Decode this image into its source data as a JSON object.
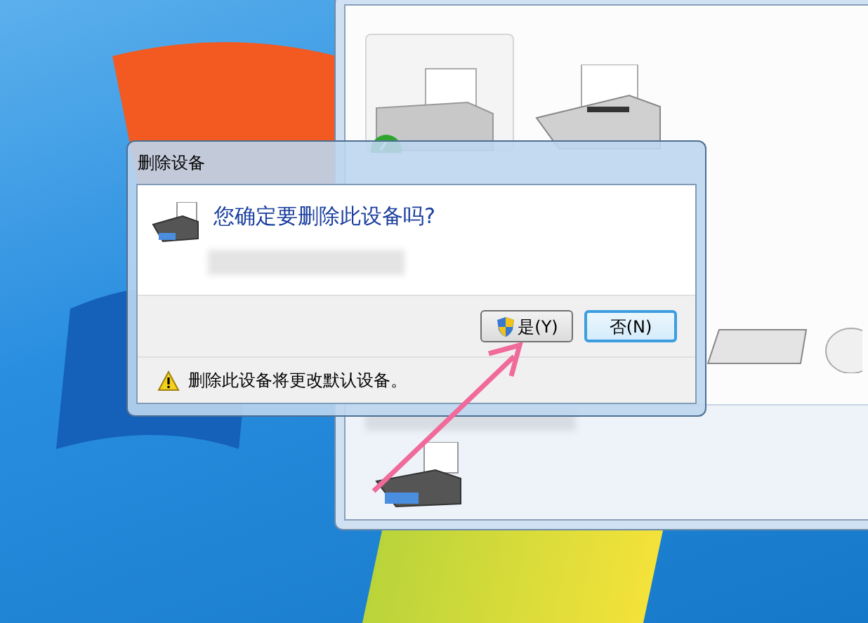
{
  "dialog": {
    "title": "删除设备",
    "question": "您确定要删除此设备吗?",
    "buttons": [
      {
        "label": "是(Y)",
        "kind": "shield",
        "default": false
      },
      {
        "label": "否(N)",
        "kind": "plain",
        "default": true
      }
    ],
    "note": "删除此设备将更改默认设备。"
  }
}
